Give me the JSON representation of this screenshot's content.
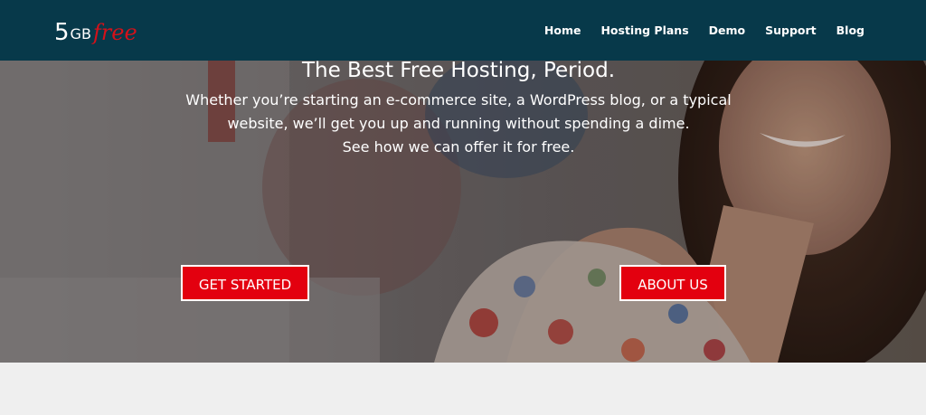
{
  "header": {
    "logo": {
      "number": "5",
      "unit": "GB",
      "word": "free"
    },
    "nav": [
      "Home",
      "Hosting Plans",
      "Demo",
      "Support",
      "Blog"
    ]
  },
  "hero": {
    "title": "The Best Free Hosting, Period.",
    "subtitle_lines": [
      "Whether you’re starting an e-commerce site, a WordPress blog, or a typical",
      "website, we’ll get you up and running without spending a dime.",
      "See how we can offer it for free."
    ],
    "buttons": {
      "get_started": "GET STARTED",
      "about_us": "ABOUT US"
    }
  },
  "colors": {
    "navbar": "#07394a",
    "button": "#e3000f",
    "logo_accent": "#d3111a",
    "below": "#efefef"
  }
}
